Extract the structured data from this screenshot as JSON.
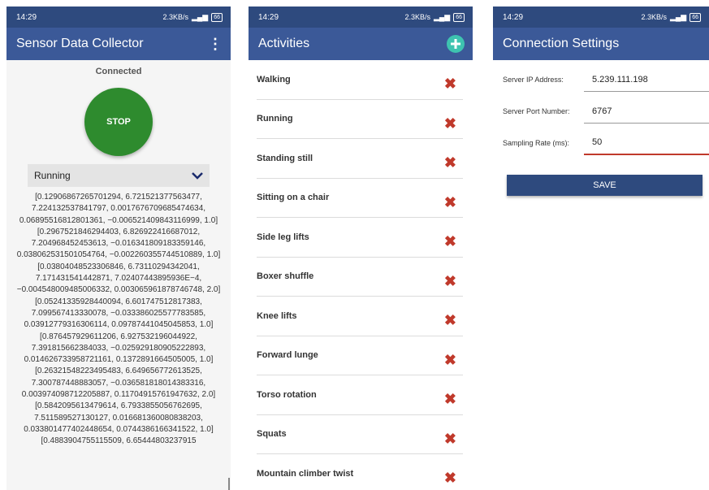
{
  "status_bar": {
    "time": "14:29",
    "speed": "2.3KB/s",
    "battery": "66"
  },
  "collector": {
    "title": "Sensor Data Collector",
    "menu_icon": "⋮",
    "connection_status": "Connected",
    "stop_label": "STOP",
    "selected_activity": "Running",
    "readings": [
      "[0.12906867265701294, 6.721521377563477, 7.224132537841797, 0.0017676709685474634, 0.06895516812801361, −0.006521409843116999, 1.0]",
      "[0.2967521846294403, 6.826922416687012, 7.204968452453613, −0.016341809183359146, 0.038062531501054764, −0.002260355744510889, 1.0]",
      "[0.03804048523306846, 6.73110294342041, 7.171431541442871, 7.02407443895936E−4, −0.004548009485006332, 0.003065961878746748, 2.0]",
      "[0.05241335928440094, 6.601747512817383, 7.099567413330078, −0.033386025577783585, 0.03912779316306114, 0.09787441045045853, 1.0]",
      "[0.876457929611206, 6.927532196044922, 7.391815662384033, −0.025929180905222893, 0.014626733958721161, 0.1372891664505005, 1.0]",
      "[0.26321548223495483, 6.649656772613525, 7.300787448883057, −0.036581818014383316, 0.003974098712205887, 0.11704915761947632, 2.0]",
      "[0.5842095613479614, 6.7933855056762695, 7.511589527130127, 0.016681360080838203, 0.033801477402448654, 0.0744386166341522, 1.0]",
      "[0.4883904755115509, 6.65444803237915"
    ]
  },
  "activities": {
    "title": "Activities",
    "items": [
      {
        "label": "Walking"
      },
      {
        "label": "Running"
      },
      {
        "label": "Standing still"
      },
      {
        "label": "Sitting on a chair"
      },
      {
        "label": "Side leg lifts"
      },
      {
        "label": "Boxer shuffle"
      },
      {
        "label": "Knee lifts"
      },
      {
        "label": "Forward lunge"
      },
      {
        "label": "Torso rotation"
      },
      {
        "label": "Squats"
      },
      {
        "label": "Mountain climber twist"
      }
    ],
    "delete_icon": "✖"
  },
  "settings": {
    "title": "Connection Settings",
    "ip_label": "Server IP Address:",
    "ip_value": "5.239.111.198",
    "port_label": "Server Port Number:",
    "port_value": "6767",
    "rate_label": "Sampling Rate (ms):",
    "rate_value": "50",
    "save_label": "SAVE"
  },
  "colors": {
    "appbar": "#3b5998",
    "statusbar": "#2e4a7e",
    "stop_button": "#2e8b2e",
    "delete_icon": "#c0392b",
    "add_button": "#3ec3b0"
  }
}
